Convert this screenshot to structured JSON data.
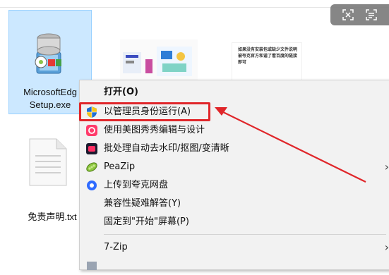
{
  "desktop": {
    "exe_label_line1": "MicrosoftEdg",
    "exe_label_line2": "Setup.exe",
    "txt_label": "免责声明.txt",
    "thumb2_text": "如果没有安装包或缺少文件说明被夸克官方和谐了看百度的链接即可"
  },
  "toolbar": {
    "icon1": "expand-icon",
    "icon2": "scan-icon"
  },
  "menu": {
    "items": [
      {
        "label": "打开(O)",
        "icon": "none"
      },
      {
        "label": "以管理员身份运行(A)",
        "icon": "uac-shield-icon"
      },
      {
        "label": "使用美图秀秀编辑与设计",
        "icon": "meitu-icon"
      },
      {
        "label": "批处理自动去水印/抠图/变清晰",
        "icon": "batch-tool-icon"
      },
      {
        "label": "PeaZip",
        "icon": "peazip-icon",
        "arrow": "›"
      },
      {
        "label": "上传到夸克网盘",
        "icon": "quark-icon"
      },
      {
        "label": "兼容性疑难解答(Y)",
        "icon": "none"
      },
      {
        "label": "固定到\"开始\"屏幕(P)",
        "icon": "none"
      },
      {
        "label": "7-Zip",
        "icon": "none",
        "arrow": "›"
      }
    ]
  },
  "colors": {
    "highlight": "#e0262a",
    "selection": "#cce8ff",
    "menu_bg": "#f2f2f2"
  }
}
